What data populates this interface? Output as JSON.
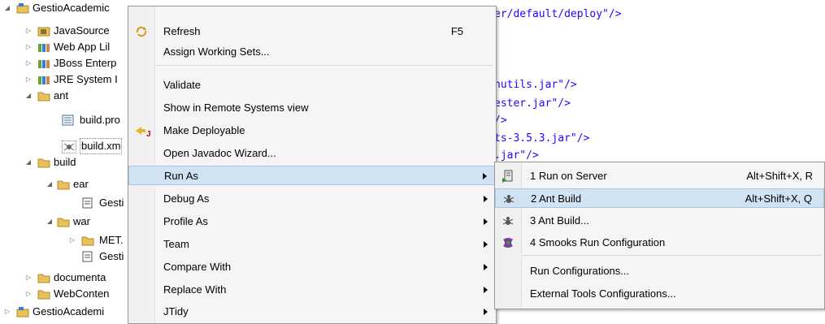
{
  "tree": {
    "items": [
      {
        "label": "GestioAcademic",
        "icon": "project-icon",
        "arrow": "◢",
        "indent": 0
      },
      {
        "label": "JavaSource",
        "icon": "package-folder-icon",
        "arrow": "▷",
        "indent": 1
      },
      {
        "label": "Web App Lil",
        "icon": "library-icon",
        "arrow": "▷",
        "indent": 1
      },
      {
        "label": "JBoss Enterp",
        "icon": "library-icon",
        "arrow": "▷",
        "indent": 1
      },
      {
        "label": "JRE System I",
        "icon": "library-icon",
        "arrow": "▷",
        "indent": 1
      },
      {
        "label": "ant",
        "icon": "folder-icon",
        "arrow": "◢",
        "indent": 1
      },
      {
        "label": "build.pro",
        "icon": "properties-file-icon",
        "arrow": "",
        "indent": 2
      },
      {
        "label": "build.xm",
        "icon": "ant-file-icon",
        "arrow": "",
        "indent": 2
      },
      {
        "label": "build",
        "icon": "folder-icon",
        "arrow": "◢",
        "indent": 1
      },
      {
        "label": "ear",
        "icon": "folder-icon",
        "arrow": "◢",
        "indent": 2
      },
      {
        "label": "Gesti",
        "icon": "file-icon",
        "arrow": "",
        "indent": 3
      },
      {
        "label": "war",
        "icon": "folder-icon",
        "arrow": "◢",
        "indent": 2
      },
      {
        "label": "MET.",
        "icon": "folder-icon",
        "arrow": "▷",
        "indent": 3
      },
      {
        "label": "Gesti",
        "icon": "file-icon",
        "arrow": "",
        "indent": 3
      },
      {
        "label": "documenta",
        "icon": "folder-icon",
        "arrow": "▷",
        "indent": 1
      },
      {
        "label": "WebConten",
        "icon": "folder-icon",
        "arrow": "▷",
        "indent": 1
      },
      {
        "label": "GestioAcademi",
        "icon": "project-icon",
        "arrow": "▷",
        "indent": 0
      }
    ]
  },
  "editor": {
    "lines": [
      {
        "text": "er/default/deploy\"/>",
        "row": 0
      },
      {
        "text": "nutils.jar\"/>",
        "row": 4
      },
      {
        "text": "ester.jar\"/>",
        "row": 5
      },
      {
        "text": "/>",
        "row": 6
      },
      {
        "text": "ts-3.5.3.jar\"/>",
        "row": 7
      },
      {
        "text": ".jar\"/>",
        "row": 8
      }
    ]
  },
  "menu": {
    "items": [
      {
        "label": "Refresh",
        "accel": "F5",
        "icon": "refresh-icon"
      },
      {
        "label": "Assign Working Sets...",
        "accel": "",
        "icon": ""
      },
      {
        "label": "Validate",
        "accel": "",
        "icon": ""
      },
      {
        "label": "Show in Remote Systems view",
        "accel": "",
        "icon": ""
      },
      {
        "label": "Make Deployable",
        "accel": "",
        "icon": "deploy-icon"
      },
      {
        "label": "Open Javadoc Wizard...",
        "accel": "",
        "icon": ""
      },
      {
        "label": "Run As",
        "accel": "",
        "icon": "",
        "submenu": true
      },
      {
        "label": "Debug As",
        "accel": "",
        "icon": "",
        "submenu": true
      },
      {
        "label": "Profile As",
        "accel": "",
        "icon": "",
        "submenu": true
      },
      {
        "label": "Team",
        "accel": "",
        "icon": "",
        "submenu": true
      },
      {
        "label": "Compare With",
        "accel": "",
        "icon": "",
        "submenu": true
      },
      {
        "label": "Replace With",
        "accel": "",
        "icon": "",
        "submenu": true
      },
      {
        "label": "JTidy",
        "accel": "",
        "icon": "",
        "submenu": true
      }
    ]
  },
  "submenu": {
    "items": [
      {
        "label": "1 Run on Server",
        "accel": "Alt+Shift+X, R",
        "icon": "server-icon"
      },
      {
        "label": "2 Ant Build",
        "accel": "Alt+Shift+X, Q",
        "icon": "ant-icon"
      },
      {
        "label": "3 Ant Build...",
        "accel": "",
        "icon": "ant-icon"
      },
      {
        "label": "4 Smooks Run Configuration",
        "accel": "",
        "icon": "smooks-icon"
      },
      {
        "label": "Run Configurations...",
        "accel": "",
        "icon": ""
      },
      {
        "label": "External Tools Configurations...",
        "accel": "",
        "icon": ""
      }
    ]
  },
  "colors": {
    "menu_highlight": "#d1e2f2",
    "code_string": "#2a00ff",
    "folder": "#e8c15a"
  }
}
